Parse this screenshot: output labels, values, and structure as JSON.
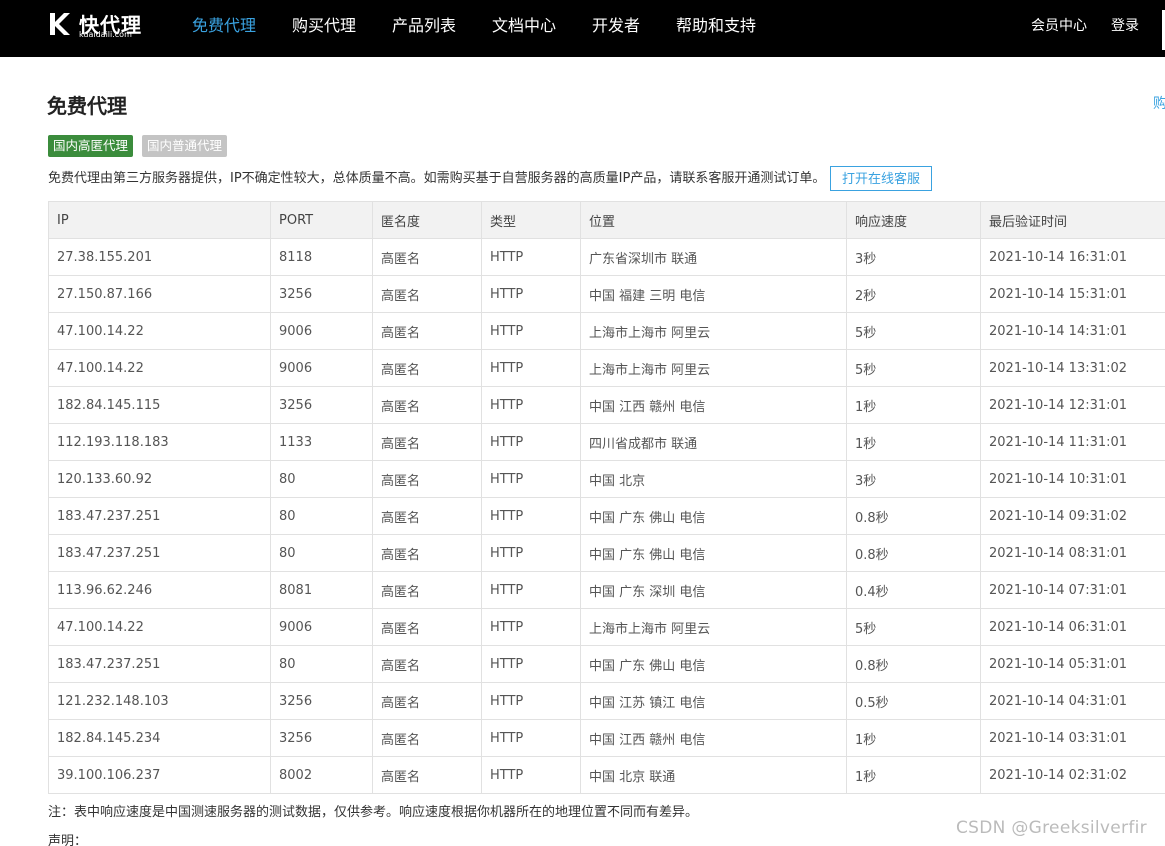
{
  "logo": {
    "text": "快代理",
    "sub": "kuaidaili.com"
  },
  "nav": {
    "items": [
      {
        "label": "免费代理",
        "active": true
      },
      {
        "label": "购买代理"
      },
      {
        "label": "产品列表"
      },
      {
        "label": "文档中心"
      },
      {
        "label": "开发者"
      },
      {
        "label": "帮助和支持"
      }
    ],
    "member": "会员中心",
    "login": "登录"
  },
  "page": {
    "title": "免费代理",
    "edge_link": "购"
  },
  "tabs": [
    {
      "label": "国内高匿代理",
      "active": true
    },
    {
      "label": "国内普通代理",
      "active": false
    }
  ],
  "description": "免费代理由第三方服务器提供，IP不确定性较大，总体质量不高。如需购买基于自营服务器的高质量IP产品，请联系客服开通测试订单。",
  "service_button": "打开在线客服",
  "table": {
    "headers": [
      "IP",
      "PORT",
      "匿名度",
      "类型",
      "位置",
      "响应速度",
      "最后验证时间"
    ],
    "rows": [
      [
        "27.38.155.201",
        "8118",
        "高匿名",
        "HTTP",
        "广东省深圳市 联通",
        "3秒",
        "2021-10-14 16:31:01"
      ],
      [
        "27.150.87.166",
        "3256",
        "高匿名",
        "HTTP",
        "中国 福建 三明 电信",
        "2秒",
        "2021-10-14 15:31:01"
      ],
      [
        "47.100.14.22",
        "9006",
        "高匿名",
        "HTTP",
        "上海市上海市 阿里云",
        "5秒",
        "2021-10-14 14:31:01"
      ],
      [
        "47.100.14.22",
        "9006",
        "高匿名",
        "HTTP",
        "上海市上海市 阿里云",
        "5秒",
        "2021-10-14 13:31:02"
      ],
      [
        "182.84.145.115",
        "3256",
        "高匿名",
        "HTTP",
        "中国 江西 赣州 电信",
        "1秒",
        "2021-10-14 12:31:01"
      ],
      [
        "112.193.118.183",
        "1133",
        "高匿名",
        "HTTP",
        "四川省成都市 联通",
        "1秒",
        "2021-10-14 11:31:01"
      ],
      [
        "120.133.60.92",
        "80",
        "高匿名",
        "HTTP",
        "中国 北京",
        "3秒",
        "2021-10-14 10:31:01"
      ],
      [
        "183.47.237.251",
        "80",
        "高匿名",
        "HTTP",
        "中国 广东 佛山 电信",
        "0.8秒",
        "2021-10-14 09:31:02"
      ],
      [
        "183.47.237.251",
        "80",
        "高匿名",
        "HTTP",
        "中国 广东 佛山 电信",
        "0.8秒",
        "2021-10-14 08:31:01"
      ],
      [
        "113.96.62.246",
        "8081",
        "高匿名",
        "HTTP",
        "中国 广东 深圳 电信",
        "0.4秒",
        "2021-10-14 07:31:01"
      ],
      [
        "47.100.14.22",
        "9006",
        "高匿名",
        "HTTP",
        "上海市上海市 阿里云",
        "5秒",
        "2021-10-14 06:31:01"
      ],
      [
        "183.47.237.251",
        "80",
        "高匿名",
        "HTTP",
        "中国 广东 佛山 电信",
        "0.8秒",
        "2021-10-14 05:31:01"
      ],
      [
        "121.232.148.103",
        "3256",
        "高匿名",
        "HTTP",
        "中国 江苏 镇江 电信",
        "0.5秒",
        "2021-10-14 04:31:01"
      ],
      [
        "182.84.145.234",
        "3256",
        "高匿名",
        "HTTP",
        "中国 江西 赣州 电信",
        "1秒",
        "2021-10-14 03:31:01"
      ],
      [
        "39.100.106.237",
        "8002",
        "高匿名",
        "HTTP",
        "中国 北京 联通",
        "1秒",
        "2021-10-14 02:31:02"
      ]
    ]
  },
  "note": "注：表中响应速度是中国测速服务器的测试数据，仅供参考。响应速度根据你机器所在的地理位置不同而有差异。",
  "statement": "声明：",
  "watermark": "CSDN @Greeksilverfir",
  "colors": {
    "accent": "#3aa2e0",
    "tag_active": "#3b8c3c",
    "tag_inactive": "#c4c4c4",
    "header_bg": "#000000"
  }
}
